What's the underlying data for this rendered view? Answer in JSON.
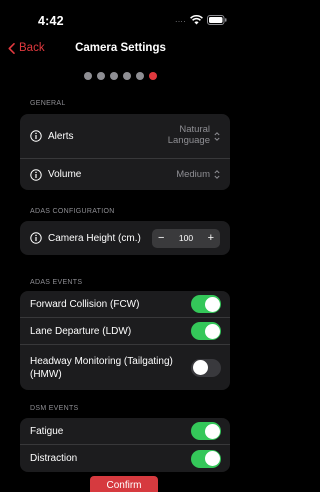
{
  "status_bar": {
    "time": "4:42",
    "signal": "....",
    "wifi_icon": "wifi-icon",
    "battery_icon": "battery-icon"
  },
  "nav": {
    "back_label": "Back",
    "back_icon": "chevron-left-icon",
    "title": "Camera Settings"
  },
  "pager": {
    "total": 6,
    "active_index": 5,
    "inactive_color": "#8e8e93",
    "active_color": "#e0393e"
  },
  "general": {
    "header": "GENERAL",
    "alerts": {
      "label": "Alerts",
      "value_line1": "Natural",
      "value_line2": "Language"
    },
    "volume": {
      "label": "Volume",
      "value": "Medium"
    }
  },
  "adas_config": {
    "header": "ADAS CONFIGURATION",
    "camera_height": {
      "label": "Camera Height (cm.)",
      "minus": "−",
      "value": "100",
      "plus": "+"
    }
  },
  "adas_events": {
    "header": "ADAS EVENTS",
    "items": [
      {
        "label": "Forward Collision (FCW)",
        "enabled": true
      },
      {
        "label": "Lane Departure (LDW)",
        "enabled": true
      },
      {
        "label": "Headway Monitoring (Tailgating) (HMW)",
        "enabled": false
      }
    ]
  },
  "dsm_events": {
    "header": "DSM EVENTS",
    "items": [
      {
        "label": "Fatigue",
        "enabled": true
      },
      {
        "label": "Distraction",
        "enabled": true
      }
    ]
  },
  "confirm_label": "Confirm",
  "colors": {
    "accent": "#e0393e",
    "toggle_on": "#34c759",
    "toggle_off": "#39393d",
    "group_bg": "#1c1c1e",
    "background": "#000000"
  }
}
